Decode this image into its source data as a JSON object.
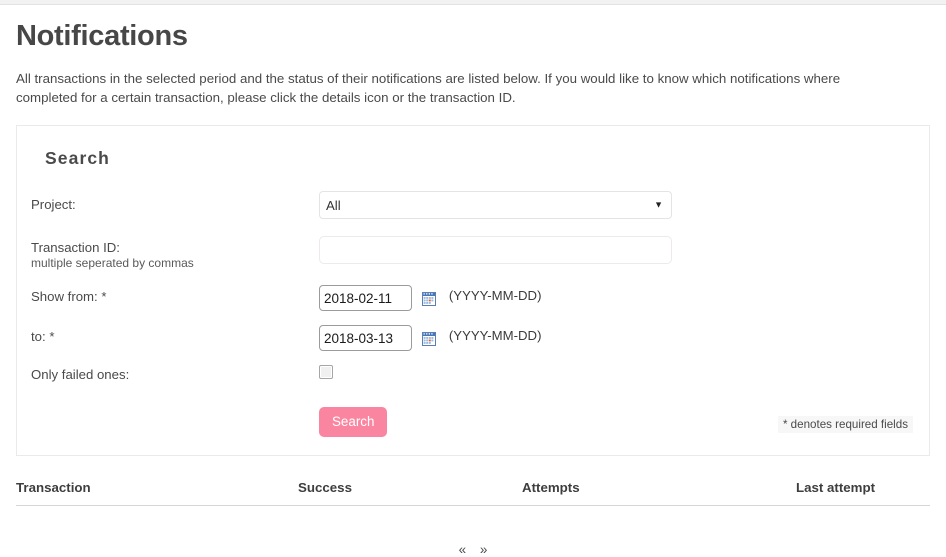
{
  "page": {
    "title": "Notifications",
    "intro": "All transactions in the selected period and the status of their notifications are listed below. If you would like to know which notifications where completed for a certain transaction, please click the details icon or the transaction ID."
  },
  "search": {
    "heading": "Search",
    "project": {
      "label": "Project:",
      "selected": "All",
      "options": [
        "All"
      ]
    },
    "transaction": {
      "label": "Transaction ID:",
      "sub_label": "multiple seperated by commas",
      "value": "",
      "placeholder": ""
    },
    "show_from": {
      "label": "Show from: *",
      "value": "2018-02-11",
      "hint": "(YYYY-MM-DD)",
      "icon": "calendar-icon"
    },
    "show_to": {
      "label": "to: *",
      "value": "2018-03-13",
      "hint": "(YYYY-MM-DD)",
      "icon": "calendar-icon"
    },
    "only_failed": {
      "label": "Only failed ones:",
      "checked": false
    },
    "submit_label": "Search",
    "required_note": "* denotes required fields",
    "accent_color": "#fa85a0"
  },
  "results": {
    "columns": [
      "Transaction",
      "Success",
      "Attempts",
      "Last attempt"
    ],
    "rows": []
  },
  "pagination": {
    "prev": "«",
    "next": "»"
  }
}
